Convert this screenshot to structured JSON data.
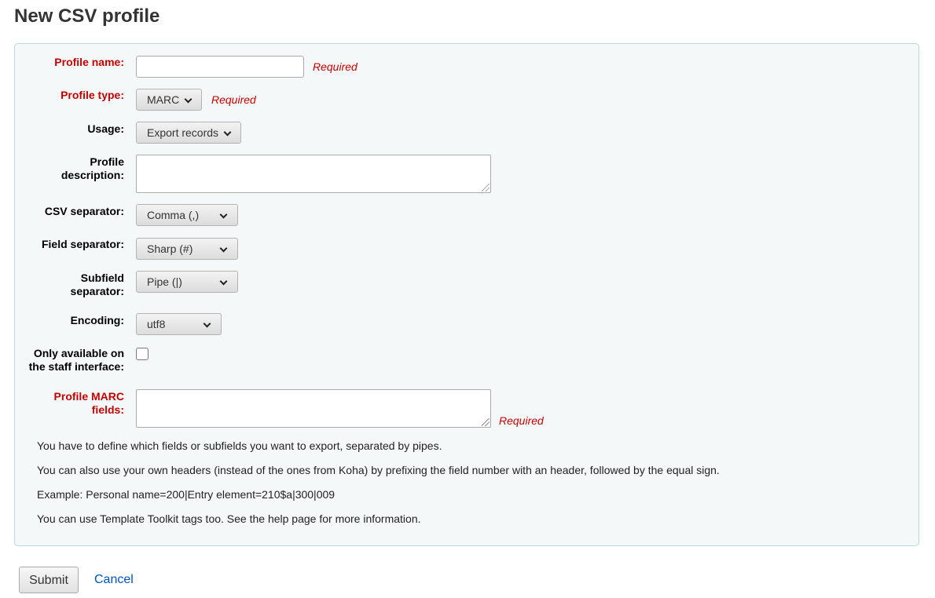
{
  "page_title": "New CSV profile",
  "form": {
    "profile_name": {
      "label": "Profile name:",
      "value": "",
      "required_text": "Required"
    },
    "profile_type": {
      "label": "Profile type:",
      "selected": "MARC",
      "required_text": "Required"
    },
    "usage": {
      "label": "Usage:",
      "selected": "Export records"
    },
    "profile_description": {
      "label_line1": "Profile",
      "label_line2": "description:",
      "value": ""
    },
    "csv_separator": {
      "label": "CSV separator:",
      "selected": "Comma (,)"
    },
    "field_separator": {
      "label": "Field separator:",
      "selected": "Sharp (#)"
    },
    "subfield_separator": {
      "label_line1": "Subfield",
      "label_line2": "separator:",
      "selected": "Pipe (|)"
    },
    "encoding": {
      "label": "Encoding:",
      "selected": "utf8"
    },
    "staff_only": {
      "label_line1": "Only available on",
      "label_line2": "the staff interface:",
      "checked": false
    },
    "profile_marc_fields": {
      "label_line1": "Profile MARC",
      "label_line2": "fields:",
      "value": "",
      "required_text": "Required"
    },
    "hints": [
      "You have to define which fields or subfields you want to export, separated by pipes.",
      "You can also use your own headers (instead of the ones from Koha) by prefixing the field number with an header, followed by the equal sign.",
      "Example: Personal name=200|Entry element=210$a|300|009",
      "You can use Template Toolkit tags too. See the help page for more information."
    ]
  },
  "actions": {
    "submit_label": "Submit",
    "cancel_label": "Cancel"
  },
  "colors": {
    "required": "#bc0000",
    "link": "#0053b3",
    "panel_bg": "#f4f8f9",
    "panel_border": "#b9d8d9"
  }
}
